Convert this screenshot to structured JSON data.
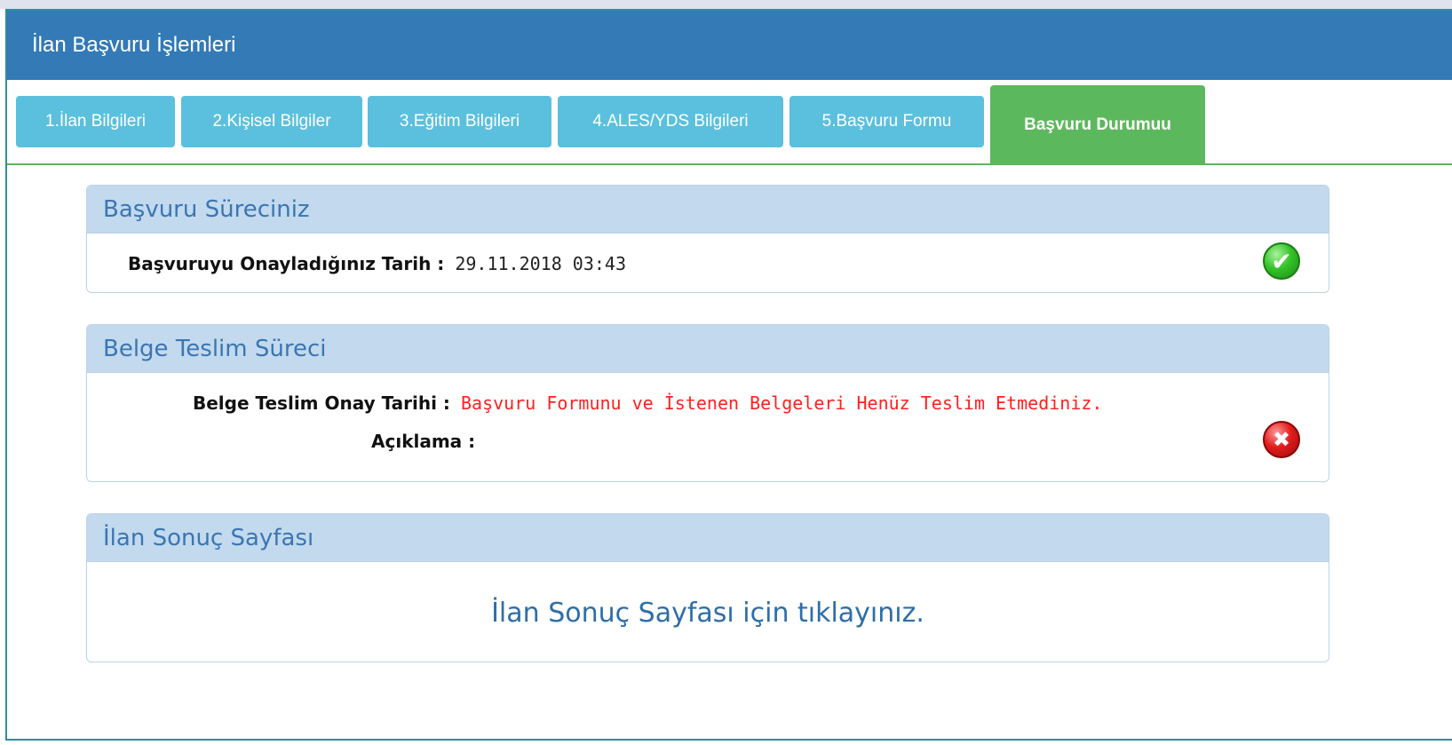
{
  "panel": {
    "title": "İlan Başvuru İşlemleri"
  },
  "tabs": [
    {
      "label": "1.İlan Bilgileri"
    },
    {
      "label": "2.Kişisel Bilgiler"
    },
    {
      "label": "3.Eğitim Bilgileri"
    },
    {
      "label": "4.ALES/YDS Bilgileri"
    },
    {
      "label": "5.Başvuru Formu"
    },
    {
      "label": "Başvuru Durumuu",
      "active": true
    }
  ],
  "application": {
    "title": "Başvuru Süreciniz",
    "approval_label": "Başvuruyu Onayladığınız Tarih :",
    "approval_value": "29.11.2018 03:43",
    "status_icon": "check-icon",
    "status_color": "#2fbf25"
  },
  "documents": {
    "title": "Belge Teslim Süreci",
    "delivery_label": "Belge Teslim Onay Tarihi :",
    "delivery_value": "Başvuru Formunu ve İstenen Belgeleri Henüz Teslim Etmediniz.",
    "note_label": "Açıklama :",
    "note_value": "",
    "status_icon": "cross-icon",
    "status_color": "#e21d1d"
  },
  "results": {
    "title": "İlan Sonuç Sayfası",
    "link_text": "İlan Sonuç Sayfası için tıklayınız."
  },
  "colors": {
    "header": "#337ab7",
    "tab": "#5bc0de",
    "tab_active": "#5cb85c",
    "box_header": "#c2d9ee",
    "error_text": "#ff2020"
  }
}
